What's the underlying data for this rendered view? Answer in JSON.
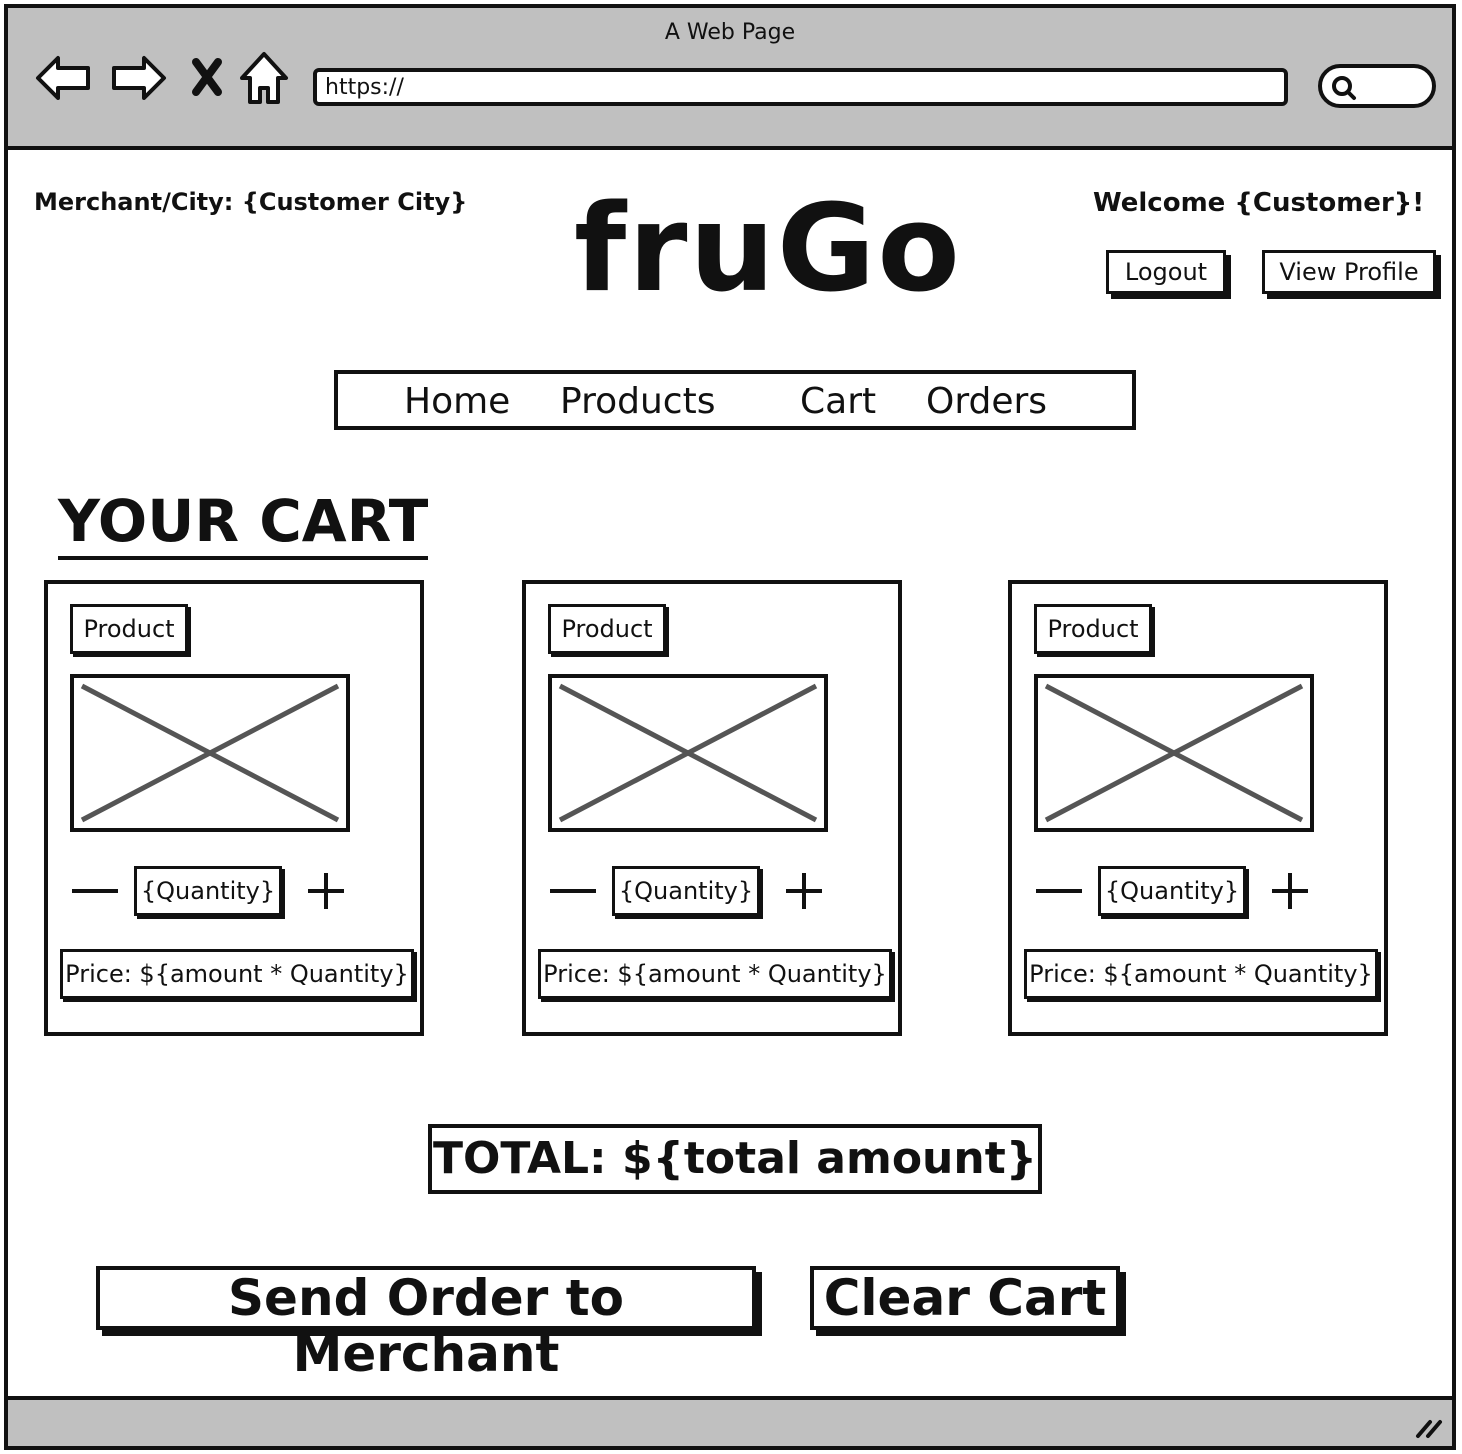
{
  "window": {
    "title": "A Web Page",
    "url": "https://"
  },
  "header": {
    "merchant_city": "Merchant/City: {Customer City}",
    "logo": "fruGo",
    "welcome": "Welcome {Customer}!",
    "logout_label": "Logout",
    "view_profile_label": "View Profile"
  },
  "nav": {
    "items": [
      {
        "label": "Home"
      },
      {
        "label": "Products"
      },
      {
        "label": "Cart"
      },
      {
        "label": "Orders"
      }
    ]
  },
  "cart": {
    "title": "YOUR CART",
    "items": [
      {
        "product": "Product",
        "quantity": "{Quantity}",
        "price": "Price: ${amount * Quantity}"
      },
      {
        "product": "Product",
        "quantity": "{Quantity}",
        "price": "Price: ${amount * Quantity}"
      },
      {
        "product": "Product",
        "quantity": "{Quantity}",
        "price": "Price: ${amount * Quantity}"
      }
    ],
    "total": "TOTAL: ${total amount}",
    "send_order_label": "Send Order to Merchant",
    "clear_cart_label": "Clear Cart"
  },
  "icons": {
    "back": "back-arrow-icon",
    "forward": "forward-arrow-icon",
    "stop": "close-icon",
    "home": "home-icon",
    "search": "search-icon",
    "image_placeholder": "image-placeholder-icon",
    "minus": "minus-icon",
    "plus": "plus-icon",
    "resize": "resize-grip-icon"
  },
  "colors": {
    "chrome": "#c0c0c0",
    "ink": "#111111",
    "placeholder_line": "#555555",
    "background": "#ffffff"
  }
}
